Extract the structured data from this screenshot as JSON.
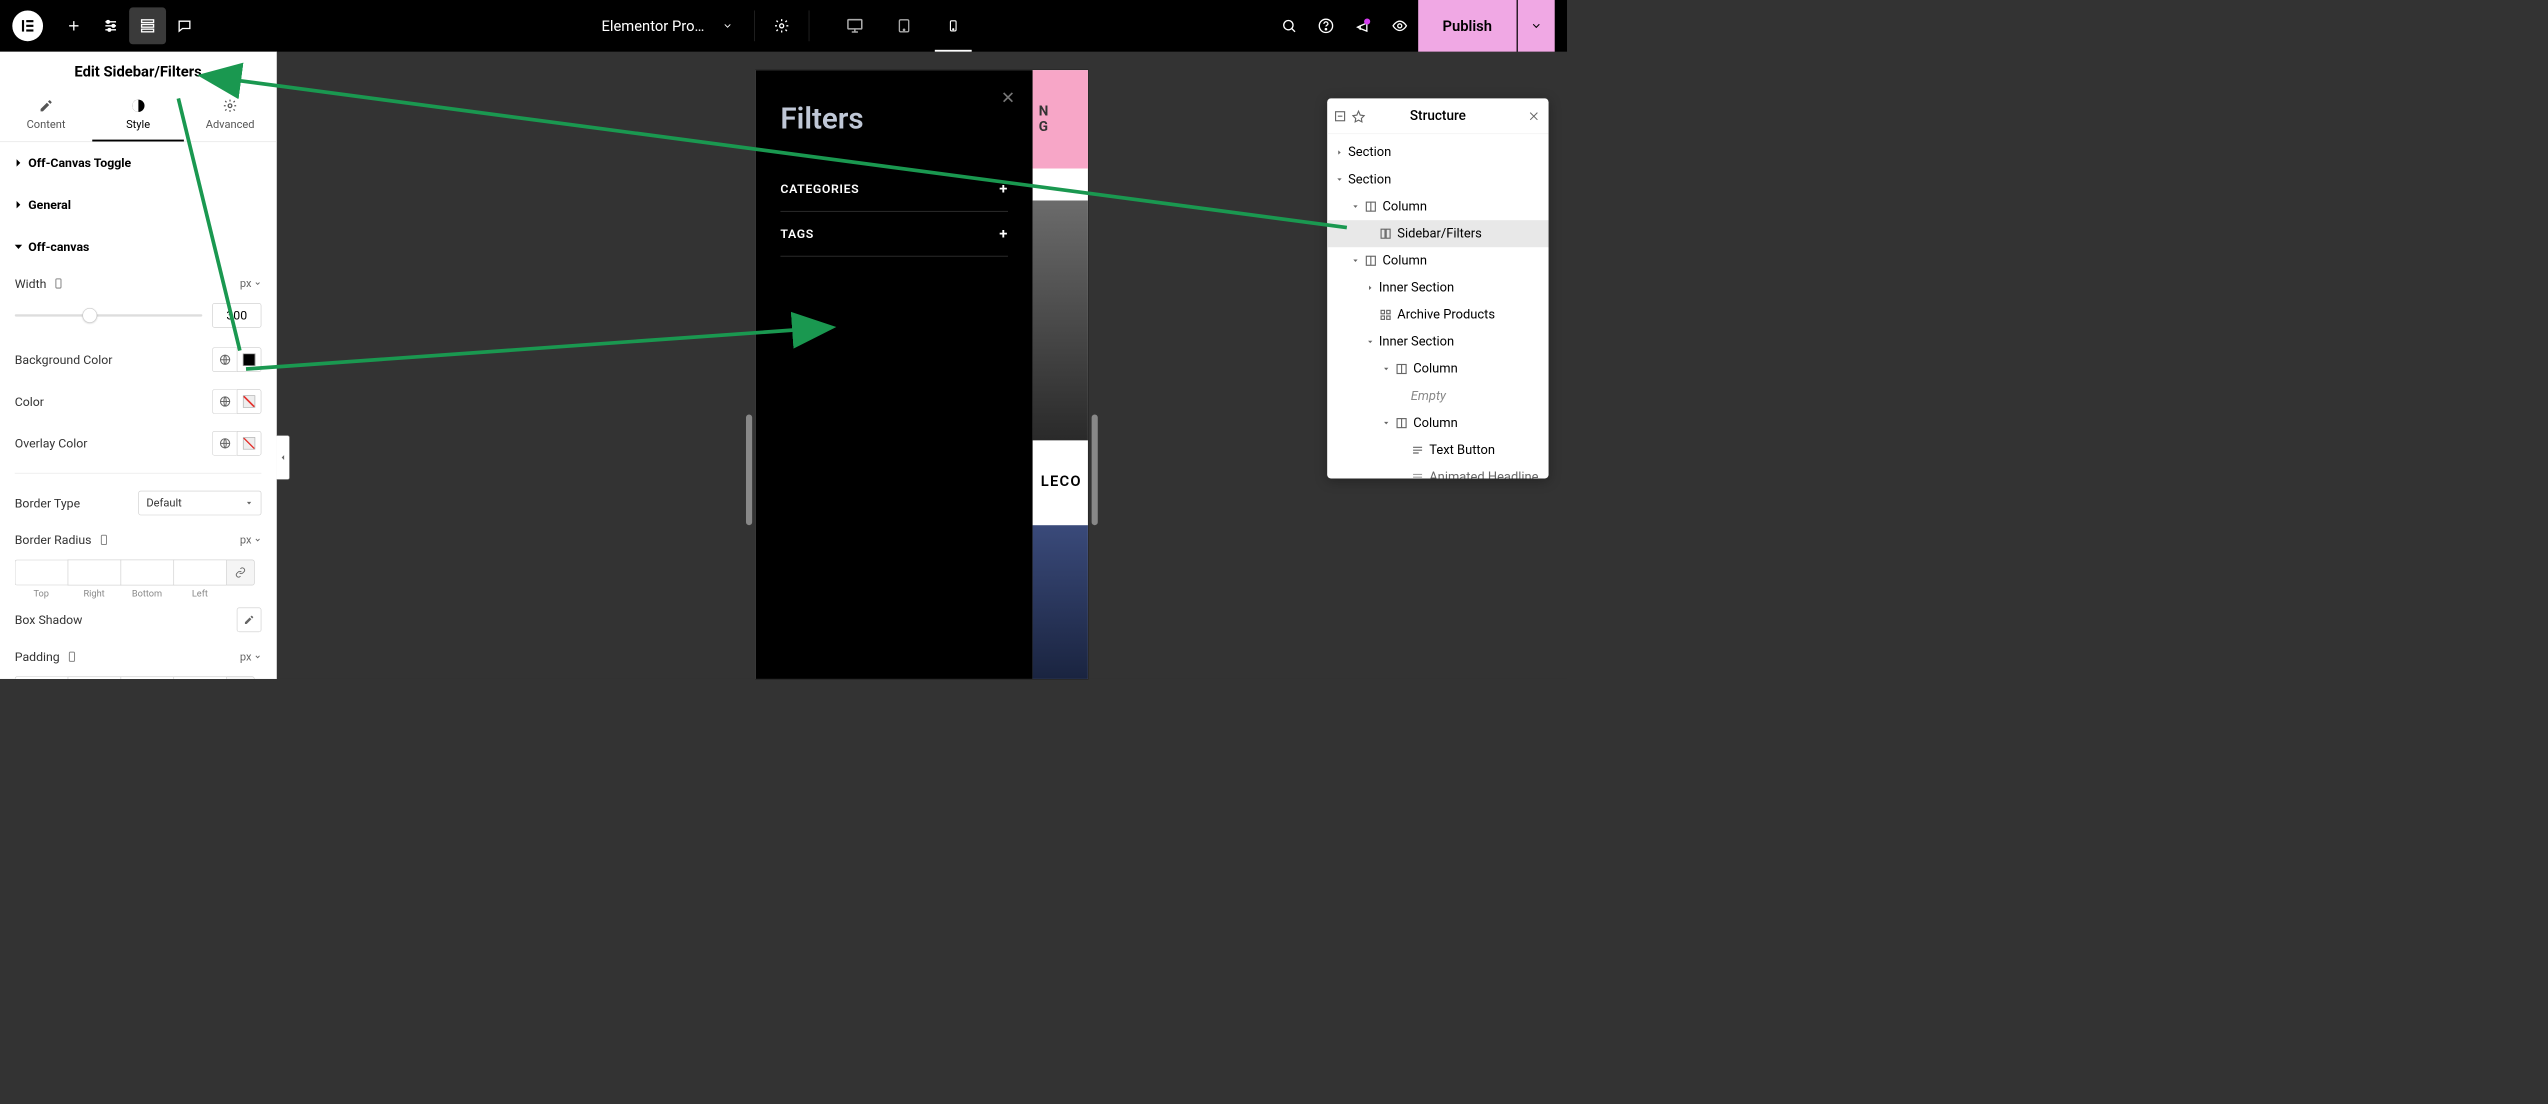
{
  "topbar": {
    "doc_title": "Elementor Produ…",
    "publish": "Publish"
  },
  "panel": {
    "title": "Edit Sidebar/Filters",
    "tabs": {
      "content": "Content",
      "style": "Style",
      "advanced": "Advanced"
    },
    "sections": {
      "toggle": "Off-Canvas Toggle",
      "general": "General",
      "offcanvas": "Off-canvas"
    },
    "controls": {
      "width": "Width",
      "width_unit": "px",
      "width_value": "300",
      "bg_color": "Background Color",
      "color": "Color",
      "overlay": "Overlay Color",
      "border_type": "Border Type",
      "border_type_val": "Default",
      "border_radius": "Border Radius",
      "radius_unit": "px",
      "box_shadow": "Box Shadow",
      "padding": "Padding",
      "padding_unit": "px",
      "sides": {
        "top": "Top",
        "right": "Right",
        "bottom": "Bottom",
        "left": "Left"
      }
    }
  },
  "offcanvas": {
    "title": "Filters",
    "cat": "CATEGORIES",
    "tags": "TAGS"
  },
  "preview": {
    "banner_line1": "N",
    "banner_line2": "G",
    "product": "LECO"
  },
  "structure": {
    "title": "Structure",
    "items": [
      {
        "label": "Section",
        "indent": 0,
        "caret": "right"
      },
      {
        "label": "Section",
        "indent": 0,
        "caret": "down"
      },
      {
        "label": "Column",
        "indent": 1,
        "caret": "down",
        "icon": "column"
      },
      {
        "label": "Sidebar/Filters",
        "indent": 2,
        "caret": "none",
        "icon": "widget",
        "selected": true
      },
      {
        "label": "Column",
        "indent": 1,
        "caret": "down",
        "icon": "column"
      },
      {
        "label": "Inner Section",
        "indent": 2,
        "caret": "right"
      },
      {
        "label": "Archive Products",
        "indent": 2,
        "caret": "none",
        "icon": "grid"
      },
      {
        "label": "Inner Section",
        "indent": 2,
        "caret": "down"
      },
      {
        "label": "Column",
        "indent": 3,
        "caret": "down",
        "icon": "column"
      },
      {
        "label": "Empty",
        "indent": 4,
        "caret": "none",
        "empty": true
      },
      {
        "label": "Column",
        "indent": 3,
        "caret": "down",
        "icon": "column"
      },
      {
        "label": "Text Button",
        "indent": 4,
        "caret": "none",
        "icon": "text"
      },
      {
        "label": "Animated Headline",
        "indent": 4,
        "caret": "none",
        "icon": "text",
        "cut": true
      }
    ]
  }
}
